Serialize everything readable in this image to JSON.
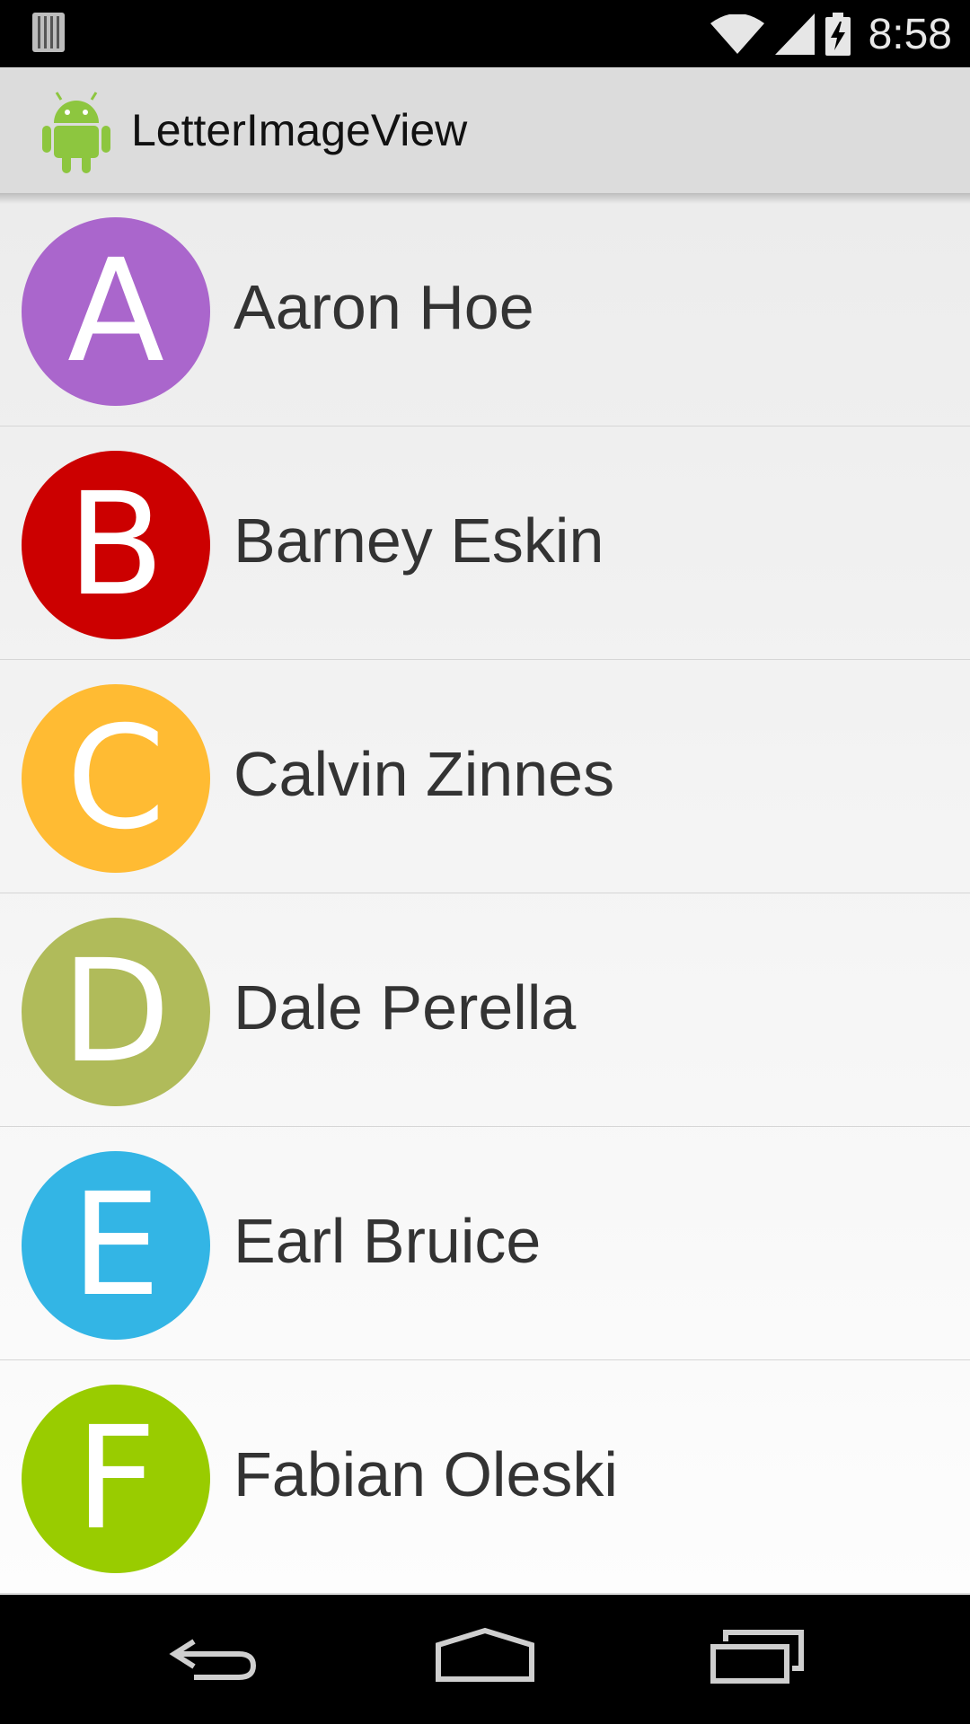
{
  "status_bar": {
    "time": "8:58"
  },
  "app": {
    "title": "LetterImageView"
  },
  "contacts": [
    {
      "letter": "A",
      "name": "Aaron Hoe",
      "color": "#aa66cc"
    },
    {
      "letter": "B",
      "name": "Barney Eskin",
      "color": "#cc0000"
    },
    {
      "letter": "C",
      "name": "Calvin Zinnes",
      "color": "#ffbb33"
    },
    {
      "letter": "D",
      "name": "Dale Perella",
      "color": "#b0bb5a"
    },
    {
      "letter": "E",
      "name": "Earl Bruice",
      "color": "#33b5e5"
    },
    {
      "letter": "F",
      "name": "Fabian Oleski",
      "color": "#99cc00"
    }
  ],
  "nav": {
    "back_icon": "back-icon",
    "home_icon": "home-icon",
    "recents_icon": "recent-apps-icon"
  }
}
